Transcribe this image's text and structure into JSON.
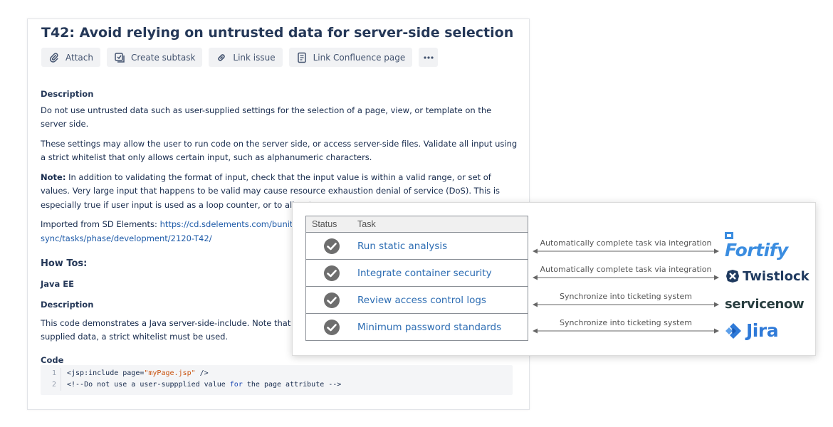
{
  "issue": {
    "title": "T42: Avoid relying on untrusted data for server-side selection",
    "toolbar": {
      "attach": "Attach",
      "create_subtask": "Create subtask",
      "link_issue": "Link issue",
      "link_confluence": "Link Confluence page"
    },
    "description_heading": "Description",
    "paragraph1": "Do not use untrusted data such as user-supplied settings for the selection of a page, view, or template on the server side.",
    "paragraph2": "These settings may allow the user to run code on the server side, or access server-side files. Validate all input using a strict whitelist that only allows certain input, such as alphanumeric characters.",
    "note_label": "Note:",
    "note_text": " In addition to validating the format of input, check that the input value is within a valid range, or set of values. Very large input that happens to be valid may cause resource exhaustion denial of service (DoS). This is especially true if user input is used as a loop counter, or to allocate resources.",
    "imported_label": "Imported from SD Elements: ",
    "imported_link_line1": "https://cd.sdelements.com/bunits/dem",
    "imported_link_line2": "sync/tasks/phase/development/2120-T42/",
    "howtos_heading": "How Tos:",
    "platform_heading": "Java EE",
    "description2_heading": "Description",
    "desc2_line1": "This code demonstrates a Java server-side-include. Note that if the c",
    "desc2_line2": "supplied data, a strict whitelist must be used.",
    "code_heading": "Code",
    "code_lines": [
      {
        "num": "1",
        "pre": "<jsp:include page=",
        "str": "\"myPage.jsp\"",
        "post": " />"
      },
      {
        "num": "2",
        "pre": "<!--Do not use a user-suppplied value ",
        "kw": "for",
        "post": " the page attribute -->"
      }
    ]
  },
  "integration": {
    "status_header": "Status",
    "task_header": "Task",
    "tasks": [
      {
        "name": "Run static analysis",
        "link_label": "Automatically complete task via integration",
        "tool": "Fortify"
      },
      {
        "name": "Integrate container security",
        "link_label": "Automatically complete task via integration",
        "tool": "Twistlock"
      },
      {
        "name": "Review access control logs",
        "link_label": "Synchronize into ticketing system",
        "tool": "servicenow"
      },
      {
        "name": "Minimum password standards",
        "link_label": "Synchronize into ticketing system",
        "tool": "Jira"
      }
    ],
    "brand_colors": {
      "fortify": "#3b8de0",
      "twistlock": "#1f3a5f",
      "servicenow": "#293e40",
      "jira": "#2f7ad8"
    }
  }
}
